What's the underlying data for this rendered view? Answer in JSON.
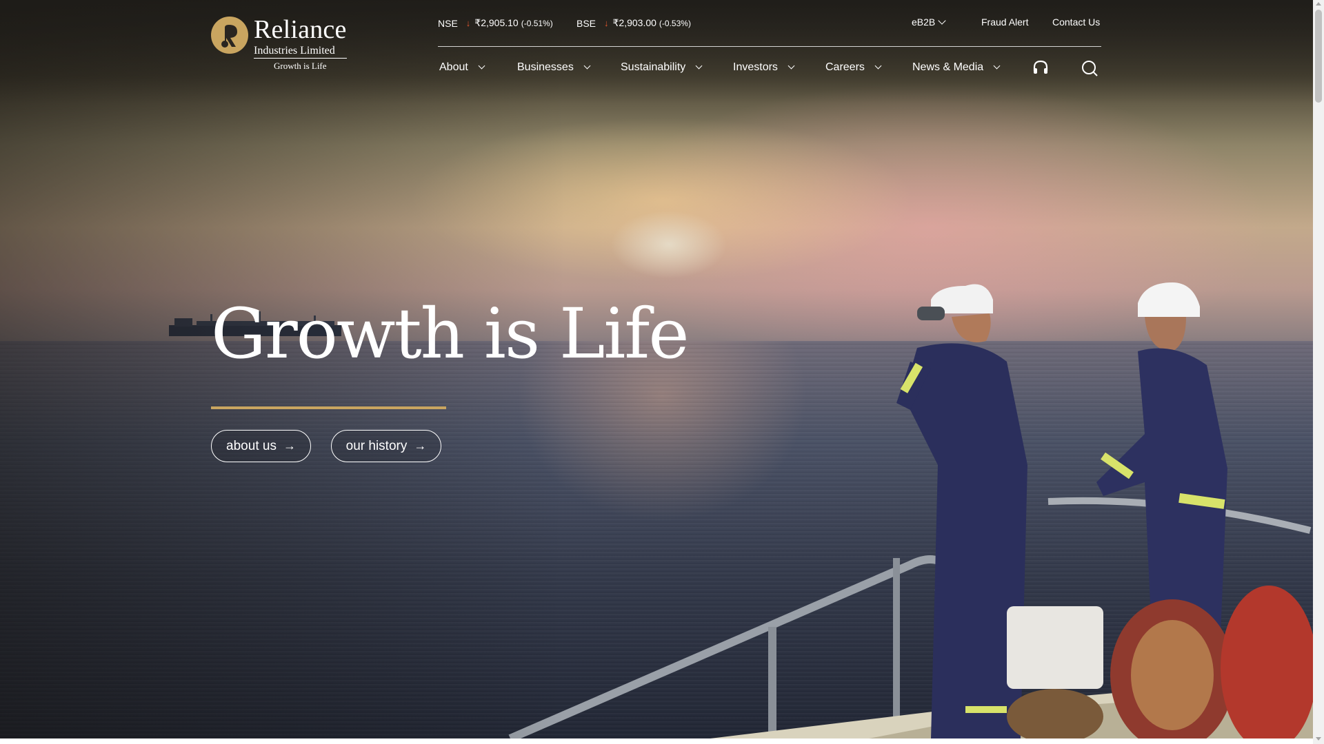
{
  "logo": {
    "name": "Reliance",
    "subtitle": "Industries Limited",
    "tagline": "Growth is Life",
    "color": "#c9a560"
  },
  "tickers": [
    {
      "exchange": "NSE",
      "value": "₹2,905.10",
      "change": "(-0.51%)",
      "direction": "down"
    },
    {
      "exchange": "BSE",
      "value": "₹2,903.00",
      "change": "(-0.53%)",
      "direction": "down"
    }
  ],
  "utility": {
    "eb2b": "eB2B",
    "fraud_alert": "Fraud Alert",
    "contact_us": "Contact Us"
  },
  "nav": {
    "items": [
      {
        "label": "About"
      },
      {
        "label": "Businesses"
      },
      {
        "label": "Sustainability"
      },
      {
        "label": "Investors"
      },
      {
        "label": "Careers"
      },
      {
        "label": "News & Media"
      }
    ],
    "icons": [
      "headphones-icon",
      "search-icon"
    ]
  },
  "hero": {
    "title": "Growth is Life",
    "buttons": [
      {
        "label": "about us"
      },
      {
        "label": "our history"
      }
    ],
    "accent": "#c9a560"
  },
  "colors": {
    "down_arrow": "#e4572e"
  }
}
